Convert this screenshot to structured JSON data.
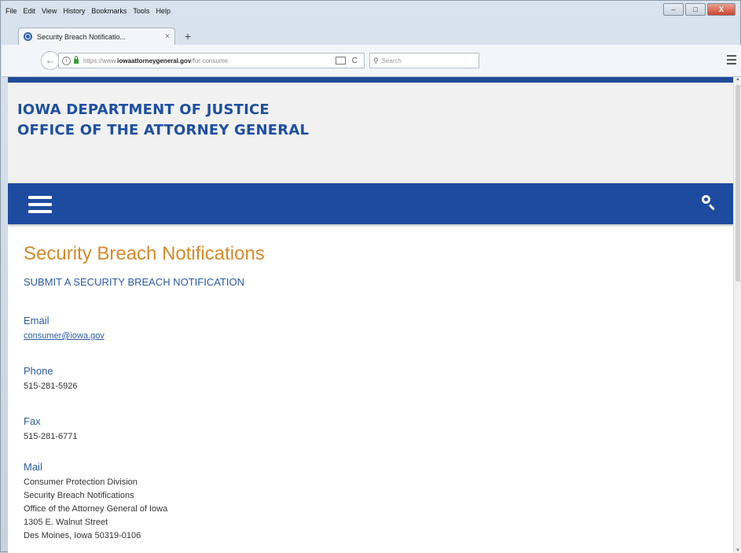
{
  "menubar": {
    "items": [
      "File",
      "Edit",
      "View",
      "History",
      "Bookmarks",
      "Tools",
      "Help"
    ]
  },
  "window_controls": {
    "minimize": "–",
    "maximize": "□",
    "close": "X"
  },
  "tab": {
    "title": "Security Breach Notificatio...",
    "close": "×",
    "new_tab": "+"
  },
  "navbar": {
    "back": "←",
    "url_prefix": "https://www.",
    "url_domain": "iowaattorneygeneral.gov",
    "url_path": "/for-consume",
    "reload": "C",
    "search_placeholder": "Search"
  },
  "site": {
    "title_line1": "IOWA DEPARTMENT OF JUSTICE",
    "title_line2": "OFFICE OF THE ATTORNEY GENERAL",
    "brand_color": "#1d4ba0",
    "accent_color": "#d48a2b"
  },
  "content": {
    "heading": "Security Breach Notifications",
    "submit_link": "SUBMIT A SECURITY BREACH NOTIFICATION",
    "email": {
      "label": "Email",
      "value": "consumer@iowa.gov"
    },
    "phone": {
      "label": "Phone",
      "value": "515-281-5926"
    },
    "fax": {
      "label": "Fax",
      "value": "515-281-6771"
    },
    "mail": {
      "label": "Mail",
      "lines": [
        "Consumer Protection Division",
        "Security Breach Notifications",
        "Office of the Attorney General of Iowa",
        "1305 E. Walnut Street",
        "Des Moines, Iowa 50319-0106"
      ]
    }
  }
}
